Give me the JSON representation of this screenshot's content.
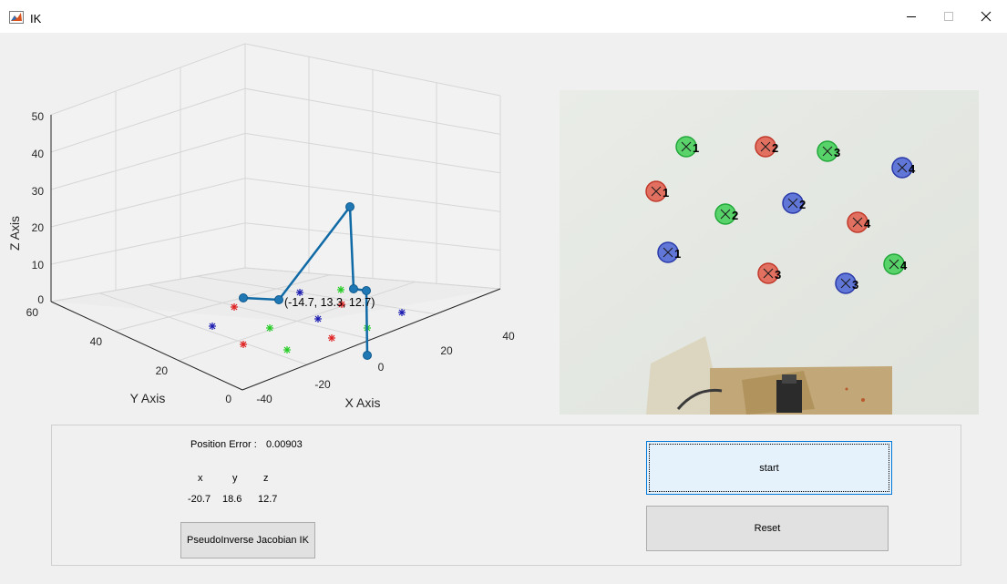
{
  "window": {
    "title": "IK",
    "icon": "matlab-icon",
    "controls": [
      "minimize-icon",
      "maximize-icon",
      "close-icon"
    ]
  },
  "plot3d": {
    "z_ticks": [
      "50",
      "40",
      "30",
      "20",
      "10",
      "0"
    ],
    "y_ticks": [
      "60",
      "40",
      "20",
      "0"
    ],
    "x_ticks": [
      "-40",
      "-20",
      "0",
      "20",
      "40"
    ],
    "z_label": "Z Axis",
    "y_label": "Y Axis",
    "x_label": "X Axis",
    "datatip": "(-14.7, 13.3, 12.7)",
    "colors": {
      "arm": "#0f6aa6",
      "red": "#e02020",
      "green": "#22cc22",
      "blue": "#1a1ab0"
    }
  },
  "camera": {
    "targets": [
      {
        "color": "green",
        "label": "1"
      },
      {
        "color": "red",
        "label": "2"
      },
      {
        "color": "green",
        "label": "3"
      },
      {
        "color": "blue",
        "label": "4"
      },
      {
        "color": "red",
        "label": "1"
      },
      {
        "color": "blue",
        "label": "2"
      },
      {
        "color": "green",
        "label": "2"
      },
      {
        "color": "red",
        "label": "4"
      },
      {
        "color": "blue",
        "label": "1"
      },
      {
        "color": "red",
        "label": "3"
      },
      {
        "color": "blue",
        "label": "3"
      },
      {
        "color": "green",
        "label": "4"
      }
    ]
  },
  "controls": {
    "position_error_label": "Position Error :",
    "position_error_value": "0.00903",
    "x_header": "x",
    "y_header": "y",
    "z_header": "z",
    "x_value": "-20.7",
    "y_value": "18.6",
    "z_value": "12.7",
    "ik_button": "PseudoInverse Jacobian IK",
    "start_button": "start",
    "reset_button": "Reset"
  }
}
